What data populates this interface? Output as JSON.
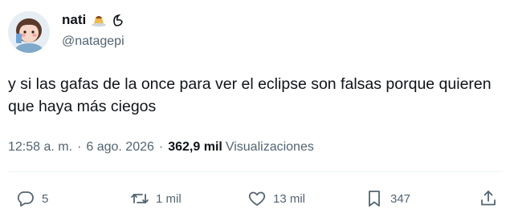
{
  "author": {
    "display_name": "nati",
    "name_emoji": "🍮",
    "name_suffix": "🪽",
    "handle": "@natagepi"
  },
  "tweet": {
    "text": "y si las gafas de la once para ver el eclipse son falsas porque quieren que haya más ciegos"
  },
  "meta": {
    "time": "12:58 a. m.",
    "separator": "·",
    "date": "6 ago. 2026",
    "views_count": "362,9 mil",
    "views_label": "Visualizaciones"
  },
  "actions": {
    "replies": "5",
    "reposts": "1 mil",
    "likes": "13 mil",
    "bookmarks": "347"
  },
  "colors": {
    "text": "#0f1419",
    "secondary": "#536471",
    "divider": "#eff3f4"
  }
}
